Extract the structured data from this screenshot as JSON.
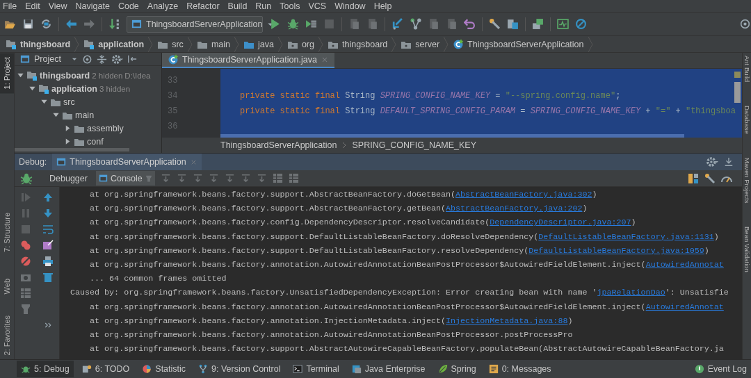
{
  "menu": [
    "File",
    "Edit",
    "View",
    "Navigate",
    "Code",
    "Analyze",
    "Refactor",
    "Build",
    "Run",
    "Tools",
    "VCS",
    "Window",
    "Help"
  ],
  "toolbar": {
    "run_config": "ThingsboardServerApplication"
  },
  "nav_path": [
    {
      "label": "thingsboard",
      "kind": "module"
    },
    {
      "label": "application",
      "kind": "module"
    },
    {
      "label": "src",
      "kind": "folder"
    },
    {
      "label": "main",
      "kind": "folder"
    },
    {
      "label": "java",
      "kind": "source"
    },
    {
      "label": "org",
      "kind": "package"
    },
    {
      "label": "thingsboard",
      "kind": "package"
    },
    {
      "label": "server",
      "kind": "package"
    },
    {
      "label": "ThingsboardServerApplication",
      "kind": "class"
    }
  ],
  "left_strip": [
    {
      "label": "1: Project",
      "selected": true
    },
    {
      "label": "7: Structure",
      "selected": false
    },
    {
      "label": "Web",
      "selected": false
    },
    {
      "label": "2: Favorites",
      "selected": false
    }
  ],
  "project": {
    "title": "Project",
    "tree": [
      {
        "label": "thingsboard",
        "kind": "module",
        "note": "2 hidden",
        "path": "D:\\Idea",
        "expanded": true,
        "children": [
          {
            "label": "application",
            "kind": "module",
            "note": "3 hidden",
            "expanded": true,
            "children": [
              {
                "label": "src",
                "kind": "folder",
                "expanded": true,
                "children": [
                  {
                    "label": "main",
                    "kind": "folder",
                    "expanded": true,
                    "children": [
                      {
                        "label": "assembly",
                        "kind": "folder",
                        "expanded": false
                      },
                      {
                        "label": "conf",
                        "kind": "folder",
                        "expanded": false
                      }
                    ]
                  }
                ]
              }
            ]
          }
        ]
      }
    ]
  },
  "editor": {
    "tab": "ThingsboardServerApplication.java",
    "lines": [
      {
        "number": "33"
      },
      {
        "number": "34",
        "tokens": [
          {
            "text": "private static final",
            "kind": "keyword"
          },
          {
            "text": " String ",
            "kind": "plain"
          },
          {
            "text": "SPRING_CONFIG_NAME_KEY",
            "kind": "constant"
          },
          {
            "text": " = ",
            "kind": "plain"
          },
          {
            "text": "\"--spring.config.name\"",
            "kind": "string"
          },
          {
            "text": ";",
            "kind": "plain"
          }
        ]
      },
      {
        "number": "35",
        "tokens": [
          {
            "text": "private static final",
            "kind": "keyword"
          },
          {
            "text": " String ",
            "kind": "plain"
          },
          {
            "text": "DEFAULT_SPRING_CONFIG_PARAM",
            "kind": "constant"
          },
          {
            "text": " = ",
            "kind": "plain"
          },
          {
            "text": "SPRING_CONFIG_NAME_KEY",
            "kind": "constant"
          },
          {
            "text": " + ",
            "kind": "plain"
          },
          {
            "text": "\"=\"",
            "kind": "string"
          },
          {
            "text": " + ",
            "kind": "plain"
          },
          {
            "text": "\"thingsboa",
            "kind": "string"
          }
        ]
      },
      {
        "number": "36"
      }
    ],
    "breadcrumb": [
      "ThingsboardServerApplication",
      "SPRING_CONFIG_NAME_KEY"
    ]
  },
  "right_strip": [
    "Ant Build",
    "Database",
    "Maven Projects",
    "Bean Validation"
  ],
  "debug": {
    "label": "Debug:",
    "session": "ThingsboardServerApplication",
    "tabs": [
      {
        "label": "Debugger",
        "selected": false
      },
      {
        "label": "Console",
        "selected": true
      }
    ]
  },
  "console": [
    {
      "segments": [
        {
          "text": "    at org.springframework.beans.factory.support.AbstractBeanFactory.doGetBean(",
          "link": false
        },
        {
          "text": "AbstractBeanFactory.java:302",
          "link": true
        },
        {
          "text": ")",
          "link": false
        }
      ]
    },
    {
      "segments": [
        {
          "text": "    at org.springframework.beans.factory.support.AbstractBeanFactory.getBean(",
          "link": false
        },
        {
          "text": "AbstractBeanFactory.java:202",
          "link": true
        },
        {
          "text": ")",
          "link": false
        }
      ]
    },
    {
      "segments": [
        {
          "text": "    at org.springframework.beans.factory.config.DependencyDescriptor.resolveCandidate(",
          "link": false
        },
        {
          "text": "DependencyDescriptor.java:207",
          "link": true
        },
        {
          "text": ")",
          "link": false
        }
      ]
    },
    {
      "segments": [
        {
          "text": "    at org.springframework.beans.factory.support.DefaultListableBeanFactory.doResolveDependency(",
          "link": false
        },
        {
          "text": "DefaultListableBeanFactory.java:1131",
          "link": true
        },
        {
          "text": ")",
          "link": false
        }
      ]
    },
    {
      "segments": [
        {
          "text": "    at org.springframework.beans.factory.support.DefaultListableBeanFactory.resolveDependency(",
          "link": false
        },
        {
          "text": "DefaultListableBeanFactory.java:1059",
          "link": true
        },
        {
          "text": ")",
          "link": false
        }
      ]
    },
    {
      "segments": [
        {
          "text": "    at org.springframework.beans.factory.annotation.AutowiredAnnotationBeanPostProcessor$AutowiredFieldElement.inject(",
          "link": false
        },
        {
          "text": "AutowiredAnnotat",
          "link": true
        }
      ]
    },
    {
      "segments": [
        {
          "text": "    ... 64 common frames omitted",
          "link": false
        }
      ]
    },
    {
      "segments": [
        {
          "text": "Caused by: org.springframework.beans.factory.UnsatisfiedDependencyException: Error creating bean with name '",
          "link": false
        },
        {
          "text": "jpaRelationDao",
          "link": true
        },
        {
          "text": "': Unsatisfie",
          "link": false
        }
      ]
    },
    {
      "segments": [
        {
          "text": "    at org.springframework.beans.factory.annotation.AutowiredAnnotationBeanPostProcessor$AutowiredFieldElement.inject(",
          "link": false
        },
        {
          "text": "AutowiredAnnotat",
          "link": true
        }
      ]
    },
    {
      "segments": [
        {
          "text": "    at org.springframework.beans.factory.annotation.InjectionMetadata.inject(",
          "link": false
        },
        {
          "text": "InjectionMetadata.java:88",
          "link": true
        },
        {
          "text": ")",
          "link": false
        }
      ]
    },
    {
      "segments": [
        {
          "text": "    at org.springframework.beans.factory.annotation.AutowiredAnnotationBeanPostProcessor.postProcessPro",
          "link": false
        }
      ]
    },
    {
      "segments": [
        {
          "text": "    at org.springframework.beans.factory.support.AbstractAutowireCapableBeanFactory.populateBean(AbstractAutowireCapableBeanFactory.ja",
          "link": false
        }
      ]
    }
  ],
  "status_bar": {
    "tools": [
      {
        "label": "5: Debug",
        "kind": "debug",
        "selected": true
      },
      {
        "label": "6: TODO",
        "kind": "todo",
        "selected": false
      },
      {
        "label": "Statistic",
        "kind": "statistic",
        "selected": false
      },
      {
        "label": "9: Version Control",
        "kind": "vcs",
        "selected": false
      },
      {
        "label": "Terminal",
        "kind": "terminal",
        "selected": false
      },
      {
        "label": "Java Enterprise",
        "kind": "enterprise",
        "selected": false
      },
      {
        "label": "Spring",
        "kind": "spring",
        "selected": false
      },
      {
        "label": "0: Messages",
        "kind": "messages",
        "selected": false
      }
    ],
    "event_log": "Event Log"
  }
}
